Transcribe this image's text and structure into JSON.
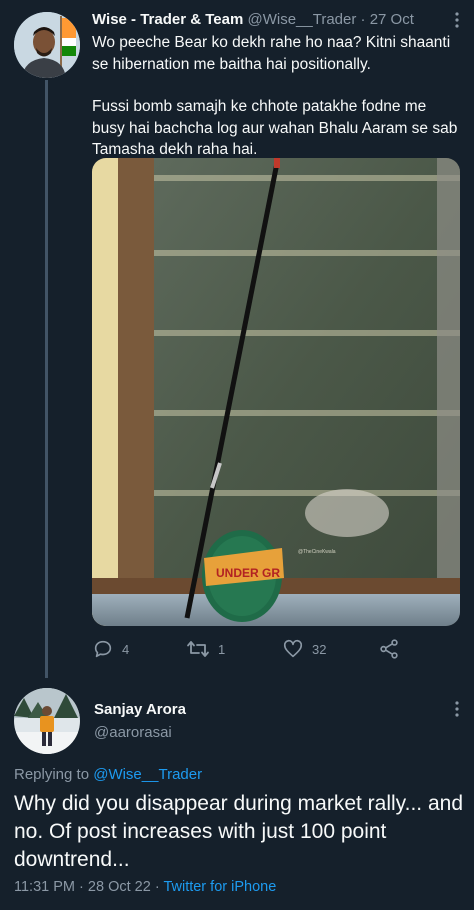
{
  "tweet1": {
    "display_name": "Wise - Trader & Team",
    "handle": "@Wise__Trader",
    "separator": "·",
    "date": "27 Oct",
    "body_paragraphs": [
      "Wo peeche Bear ko dekh rahe ho naa? Kitni shaanti se hibernation me baitha hai positionally.",
      "Fussi bomb samajh ke chhote patakhe fodne me busy hai bachcha log aur wahan Bhalu Aaram se sab Tamasha dekh raha hai."
    ],
    "image_watermark": "@TheCineKwala",
    "image_label": "UNDER GR",
    "actions": {
      "reply_count": "4",
      "retweet_count": "1",
      "like_count": "32",
      "reply_icon": "reply-icon",
      "retweet_icon": "retweet-icon",
      "like_icon": "heart-icon",
      "share_icon": "share-icon"
    }
  },
  "tweet2": {
    "display_name": "Sanjay Arora",
    "handle": "@aarorasai",
    "replying_prefix": "Replying to",
    "replying_to": "@Wise__Trader",
    "body": "Why did you disappear during market rally... and no. Of post increases with just 100 point downtrend...",
    "time": "11:31 PM",
    "date": "28 Oct 22",
    "separator": "·",
    "source": "Twitter for iPhone"
  },
  "colors": {
    "background": "#15202b",
    "text": "#f7f9f9",
    "muted": "#8b98a5",
    "link": "#1d9bf0",
    "thread_line": "#425466"
  }
}
